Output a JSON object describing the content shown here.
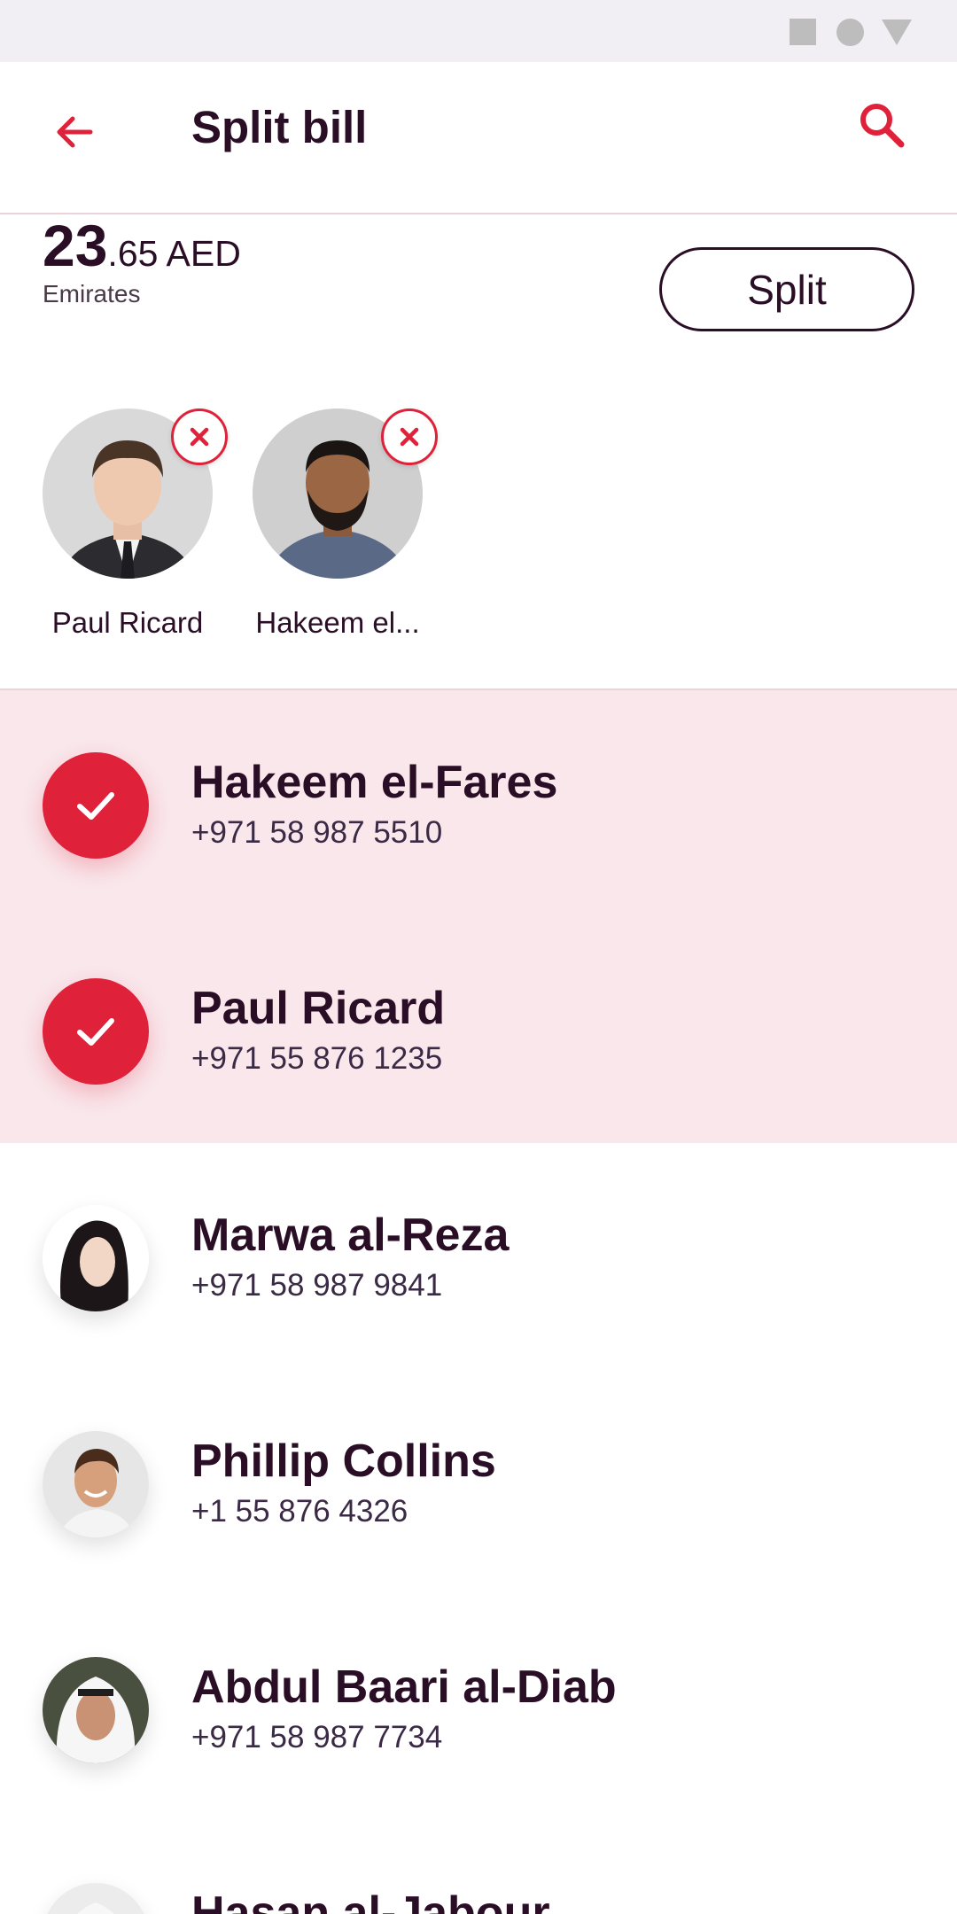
{
  "app_bar": {
    "title": "Split bill"
  },
  "bill": {
    "amount_integer": "23",
    "amount_rest": ".65 AED",
    "merchant": "Emirates",
    "split_label": "Split"
  },
  "selected_chips": [
    {
      "name": "Paul Ricard"
    },
    {
      "name": "Hakeem el..."
    }
  ],
  "contacts": [
    {
      "name": "Hakeem el-Fares",
      "phone": "+971 58 987 5510",
      "selected": true
    },
    {
      "name": "Paul Ricard",
      "phone": "+971 55 876 1235",
      "selected": true
    },
    {
      "name": "Marwa al-Reza",
      "phone": "+971 58 987 9841",
      "selected": false
    },
    {
      "name": "Phillip Collins",
      "phone": "+1 55 876 4326",
      "selected": false
    },
    {
      "name": "Abdul Baari al-Diab",
      "phone": "+971 58 987 7734",
      "selected": false
    },
    {
      "name": "Hasan al-Jabour",
      "phone": "",
      "selected": false
    }
  ],
  "colors": {
    "accent": "#e0213a",
    "text_primary": "#2a0e26",
    "selected_row_bg": "#f9e7eb",
    "status_bar_bg": "#f1eff3"
  },
  "icons": {
    "back": "arrow-left-icon",
    "search": "search-icon",
    "check": "check-icon",
    "remove": "close-icon"
  }
}
